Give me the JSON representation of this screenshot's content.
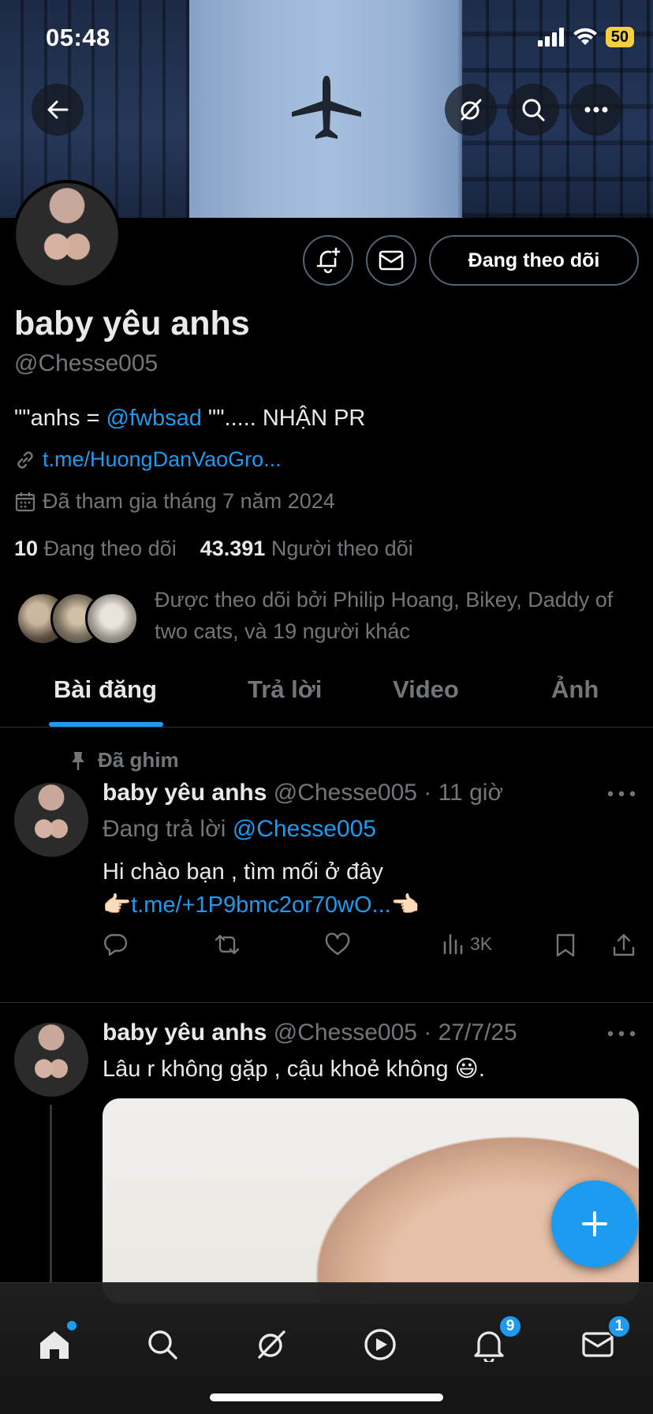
{
  "status_bar": {
    "time": "05:48",
    "battery": "50"
  },
  "profile": {
    "display_name": "baby yêu anhs",
    "handle": "@Chesse005",
    "bio_prefix": "\"\"anhs = ",
    "bio_mention": "@fwbsad",
    "bio_suffix": " \"\"..... NHẬN PR",
    "link": "t.me/HuongDanVaoGro...",
    "joined": "Đã tham gia tháng 7 năm 2024",
    "following_count": "10",
    "following_label": "Đang theo dõi",
    "followers_count": "43.391",
    "followers_label": "Người theo dõi",
    "followed_by": "Được theo dõi bởi Philip Hoang, Bikey, Daddy of two cats, và 19 người khác",
    "follow_button": "Đang theo dõi"
  },
  "tabs": [
    {
      "label": "Bài đăng",
      "active": true
    },
    {
      "label": "Trả lời",
      "active": false
    },
    {
      "label": "Video",
      "active": false
    },
    {
      "label": "Ảnh",
      "active": false
    }
  ],
  "posts": [
    {
      "pinned_label": "Đã ghim",
      "name": "baby yêu anhs",
      "meta": "@Chesse005 · 11 giờ",
      "reply_prefix": "Đang trả lời ",
      "reply_to": "@Chesse005",
      "text_line1": "Hi chào bạn , tìm mối ở đây",
      "text_link": "t.me/+1P9bmc2or70wO...",
      "views": "3K"
    },
    {
      "name": "baby yêu anhs",
      "meta": "@Chesse005 · 27/7/25",
      "text": "Lâu r không gặp , cậu khoẻ không 😃."
    }
  ],
  "nav": {
    "notifications_badge": "9",
    "messages_badge": "1"
  },
  "colors": {
    "accent": "#1d9bf0",
    "muted": "#71767b",
    "background": "#000000"
  }
}
